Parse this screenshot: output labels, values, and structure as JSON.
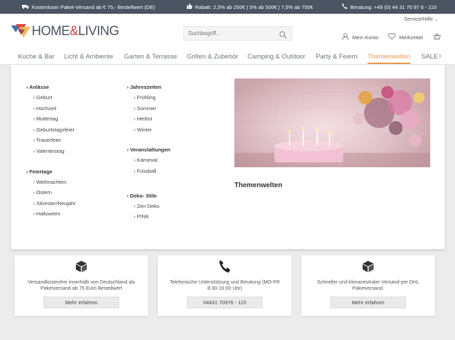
{
  "topbar": {
    "shipping": "Kostenloser Paket-Versand ab € 75,- Bestellwert (DE)",
    "discount": "Rabatt: 2,5% ab 250€ | 5% ab 500€ | 7,5% ab 750€",
    "hotline": "Beratung: +49 (0) 44 31 70 97 6 - 115"
  },
  "header": {
    "service": "Service/Hilfe",
    "logo_text_1": "HOME",
    "logo_amp": "&",
    "logo_text_2": "LIVING",
    "search_placeholder": "Suchbegriff...",
    "account": "Mein Konto",
    "wishlist": "Merkzettel"
  },
  "nav": {
    "items": [
      "Küche & Bar",
      "Licht & Ambiente",
      "Garten & Terrasse",
      "Grillen & Zubehör",
      "Camping & Outdoor",
      "Party & Feiern",
      "Themenwelten",
      "SALE"
    ]
  },
  "flyout": {
    "col1": {
      "group1": "Anlässe",
      "group1_items": [
        "Geburt",
        "Hochzeit",
        "Muttertag",
        "Geburtstagsfeier",
        "Trauerfeier",
        "Valentinstag"
      ],
      "group2": "Feiertage",
      "group2_items": [
        "Weihnachten",
        "Ostern",
        "Silvester/Neujahr",
        "Halloween"
      ]
    },
    "col2": {
      "group1": "Jahreszeiten",
      "group1_items": [
        "Frühling",
        "Sommer",
        "Herbst",
        "Winter"
      ],
      "group2": "Veranstaltungen",
      "group2_items": [
        "Karneval",
        "Fussball"
      ],
      "group3": "Deko- Stile",
      "group3_items": [
        "Zen Deko",
        "PINK"
      ]
    },
    "teaser_title": "Themenwelten"
  },
  "boxes": [
    {
      "text": "Versandkostenfrei innerhalb von Deutschland als Paketversand ab 75 Euro Bestellwert",
      "button": "Mehr erfahren"
    },
    {
      "text": "Telefonische Unterstützung und Beratung (MO-FR 8:30-16:00 Uhr)",
      "button": "04431 70976 - 115"
    },
    {
      "text": "Schneller und klimaneutraler Versand per DHL Paketversand.",
      "button": "Mehr erfahren"
    }
  ],
  "colors": {
    "topbar": "#4a5462",
    "accent": "#e69a4c",
    "logo_red": "#d5403c",
    "logo_blue": "#3a6fb0"
  }
}
